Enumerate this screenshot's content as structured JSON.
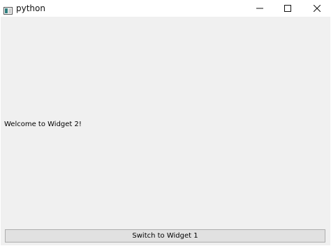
{
  "window": {
    "title": "python",
    "title_icon": "python-app-icon"
  },
  "controls": {
    "minimize_icon": "minimize-icon",
    "maximize_icon": "maximize-icon",
    "close_icon": "close-icon"
  },
  "content": {
    "label": "Welcome to Widget 2!",
    "switch_button_label": "Switch to Widget 1"
  },
  "colors": {
    "client_background": "#f0f0f0",
    "button_background": "#e1e1e1",
    "button_border": "#adadad"
  }
}
